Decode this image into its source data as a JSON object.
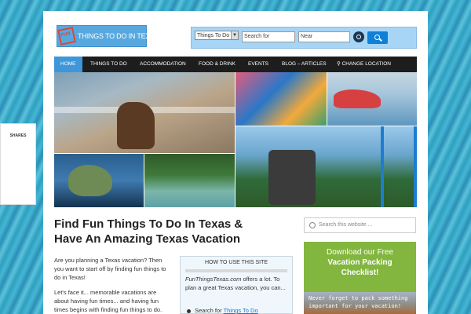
{
  "share": {
    "label": "SHARES"
  },
  "header": {
    "logo_badge": "FUN",
    "logo_text": "THINGS TO DO IN TEXAS",
    "search": {
      "category_select": "Things To Do",
      "keyword_placeholder": "Search for",
      "location_placeholder": "Near"
    }
  },
  "nav": {
    "items": [
      "HOME",
      "THINGS TO DO",
      "ACCOMMODATION",
      "FOOD & DRINK",
      "EVENTS",
      "BLOG – ARTICLES",
      "CHANGE LOCATION"
    ]
  },
  "hero": {
    "tiles": [
      "beach-horseback",
      "beach-umbrellas",
      "jet-ski",
      "roller-coaster",
      "sea-turtle",
      "river-tubing"
    ]
  },
  "main": {
    "headline_line1": "Find Fun Things To Do In Texas &",
    "headline_line2": "Have An Amazing Texas Vacation",
    "para1": "Are you planning a Texas vacation? Then you want to start off by finding fun things to do in Texas!",
    "para2": "Let's face it... memorable vacations are about having fun times... and having fun times begins with finding fun things to do."
  },
  "howto": {
    "title": "HOW TO USE THIS SITE",
    "site_name": "FunThingsTexas.com",
    "line1": " offers a lot. To plan a great Texas vacation, you can...",
    "bullet_text": "Search for ",
    "bullet_link": "Things To Do"
  },
  "sidebar": {
    "search_placeholder": "Search this website ...",
    "download_line1": "Download our Free",
    "download_line2": "Vacation Packing",
    "download_line3": "Checklist!",
    "image_caption_line1": "Never forget to pack something",
    "image_caption_line2": "important for your vacation!"
  },
  "colors": {
    "nav_active": "#3f96d8",
    "download_bg": "#82b63f",
    "search_button": "#0f80d8",
    "link": "#1a73c9"
  }
}
